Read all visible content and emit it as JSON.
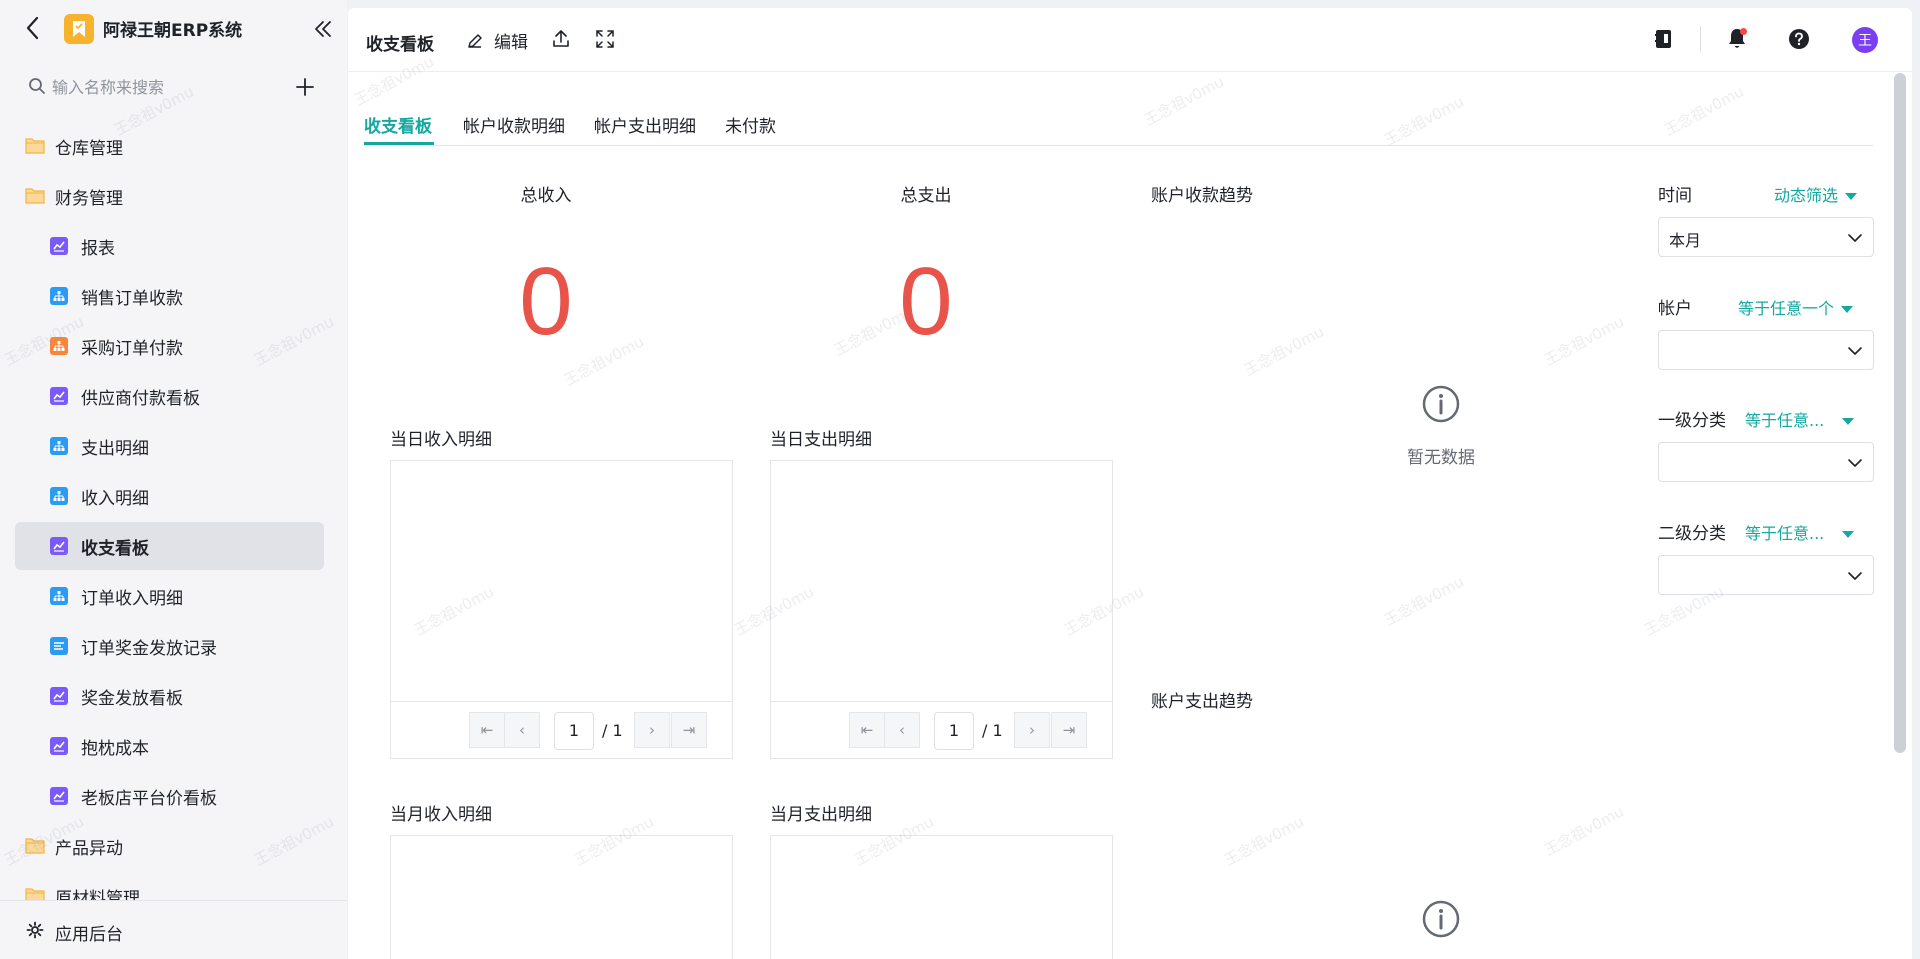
{
  "app": {
    "title": "阿禄王朝ERP系统"
  },
  "search": {
    "placeholder": "输入名称来搜索"
  },
  "sidebar": {
    "items": [
      {
        "label": "仓库管理",
        "type": "folder"
      },
      {
        "label": "财务管理",
        "type": "folder"
      },
      {
        "label": "报表",
        "type": "child",
        "icon": "chart-icon"
      },
      {
        "label": "销售订单收款",
        "type": "child",
        "icon": "org-icon"
      },
      {
        "label": "采购订单付款",
        "type": "child",
        "icon": "org-icon"
      },
      {
        "label": "供应商付款看板",
        "type": "child",
        "icon": "chart-icon"
      },
      {
        "label": "支出明细",
        "type": "child",
        "icon": "org-icon"
      },
      {
        "label": "收入明细",
        "type": "child",
        "icon": "org-icon"
      },
      {
        "label": "收支看板",
        "type": "child",
        "icon": "chart-icon",
        "active": true
      },
      {
        "label": "订单收入明细",
        "type": "child",
        "icon": "org-icon"
      },
      {
        "label": "订单奖金发放记录",
        "type": "child",
        "icon": "list-icon"
      },
      {
        "label": "奖金发放看板",
        "type": "child",
        "icon": "chart-icon"
      },
      {
        "label": "抱枕成本",
        "type": "child",
        "icon": "chart-icon"
      },
      {
        "label": "老板店平台价看板",
        "type": "child",
        "icon": "chart-icon"
      },
      {
        "label": "产品异动",
        "type": "folder"
      },
      {
        "label": "原材料管理",
        "type": "folder"
      }
    ],
    "footer_label": "应用后台"
  },
  "topbar": {
    "title": "收支看板",
    "edit_label": "编辑",
    "avatar_text": "王"
  },
  "tabs": [
    {
      "label": "收支看板",
      "active": true
    },
    {
      "label": "帐户收款明细"
    },
    {
      "label": "帐户支出明细"
    },
    {
      "label": "未付款"
    }
  ],
  "stats": {
    "income_label": "总收入",
    "income_value": "0",
    "expense_label": "总支出",
    "expense_value": "0"
  },
  "sections": {
    "daily_income": "当日收入明细",
    "daily_expense": "当日支出明细",
    "monthly_income": "当月收入明细",
    "monthly_expense": "当月支出明细",
    "account_income_trend": "账户收款趋势",
    "account_expense_trend": "账户支出趋势"
  },
  "pager": {
    "daily_income": {
      "page": "1",
      "total": "/ 1"
    },
    "daily_expense": {
      "page": "1",
      "total": "/ 1"
    }
  },
  "empty": {
    "text": "暂无数据"
  },
  "filters": {
    "time": {
      "label": "时间",
      "op": "动态筛选",
      "value": "本月"
    },
    "account": {
      "label": "帐户",
      "op": "等于任意一个",
      "value": ""
    },
    "cat1": {
      "label": "一级分类",
      "op": "等于任意...",
      "value": ""
    },
    "cat2": {
      "label": "二级分类",
      "op": "等于任意...",
      "value": ""
    }
  },
  "watermark": "王念祖v0mu",
  "colors": {
    "accent": "#14a8a0",
    "stat_value": "#e8534a",
    "avatar": "#7a3ff2",
    "logo": "#f7b32d"
  }
}
